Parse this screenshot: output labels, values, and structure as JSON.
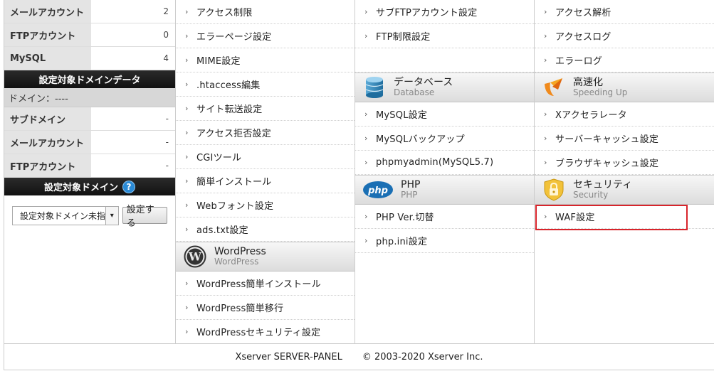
{
  "sidebar": {
    "top_stats": [
      {
        "label": "メールアカウント",
        "value": "2"
      },
      {
        "label": "FTPアカウント",
        "value": "0"
      },
      {
        "label": "MySQL",
        "value": "4"
      }
    ],
    "domain_data_header": "設定対象ドメインデータ",
    "domain_line": "ドメイン：----",
    "domain_stats": [
      {
        "label": "サブドメイン",
        "value": "-"
      },
      {
        "label": "メールアカウント",
        "value": "-"
      },
      {
        "label": "FTPアカウント",
        "value": "-"
      }
    ],
    "domain_select_header": "設定対象ドメイン",
    "help_glyph": "?",
    "select_value": "設定対象ドメイン未指",
    "set_button": "設定する"
  },
  "menu": {
    "col1": {
      "items": [
        "アクセス制限",
        "エラーページ設定",
        "MIME設定",
        ".htaccess編集",
        "サイト転送設定",
        "アクセス拒否設定",
        "CGIツール",
        "簡単インストール",
        "Webフォント設定",
        "ads.txt設定"
      ],
      "wordpress": {
        "title": "WordPress",
        "subtitle": "WordPress",
        "items": [
          "WordPress簡単インストール",
          "WordPress簡単移行",
          "WordPressセキュリティ設定"
        ]
      }
    },
    "col2": {
      "items": [
        "サブFTPアカウント設定",
        "FTP制限設定"
      ],
      "database": {
        "title": "データベース",
        "subtitle": "Database",
        "items": [
          "MySQL設定",
          "MySQLバックアップ",
          "phpmyadmin(MySQL5.7)"
        ]
      },
      "php": {
        "title": "PHP",
        "subtitle": "PHP",
        "logo_text": "php",
        "items": [
          "PHP Ver.切替",
          "php.ini設定"
        ]
      }
    },
    "col3": {
      "items": [
        "アクセス解析",
        "アクセスログ",
        "エラーログ"
      ],
      "speed": {
        "title": "高速化",
        "subtitle": "Speeding Up",
        "items": [
          "Xアクセラレータ",
          "サーバーキャッシュ設定",
          "ブラウザキャッシュ設定"
        ]
      },
      "security": {
        "title": "セキュリティ",
        "subtitle": "Security",
        "items": [
          "WAF設定"
        ]
      }
    }
  },
  "footer": {
    "product": "Xserver SERVER-PANEL",
    "copyright": "© 2003-2020 Xserver Inc."
  },
  "colors": {
    "highlight_border": "#d8242b",
    "header_dark": "#1a1a1a",
    "help_blue": "#2a8ad6"
  }
}
